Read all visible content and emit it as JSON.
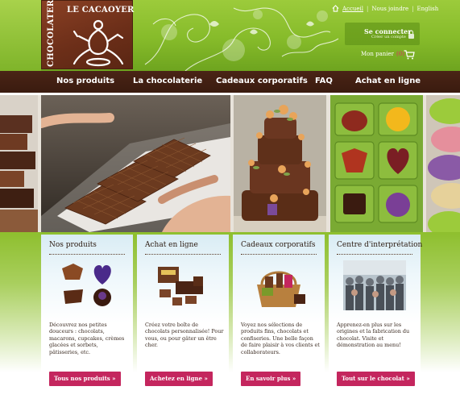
{
  "brand": {
    "name_vertical": "CHOCOLATERIE",
    "name_top": "LE CACAOYER"
  },
  "top_links": {
    "home": "Accueil",
    "join": "Nous joindre",
    "lang": "English"
  },
  "login": {
    "title": "Se connecter",
    "subtitle": "Créer un compte"
  },
  "cart": {
    "label": "Mon panier",
    "count": "(0)"
  },
  "nav": {
    "items": [
      "Nos produits",
      "La chocolaterie",
      "Cadeaux corporatifs",
      "FAQ",
      "Achat en ligne"
    ]
  },
  "columns": [
    {
      "title": "Nos produits",
      "text": "Découvrez nos petites douceurs : chocolats, macarons, cupcakes, crèmes glacées et sorbets, pâtisseries, etc.",
      "button": "Tous nos produits »"
    },
    {
      "title": "Achat en ligne",
      "text": "Créez votre boîte de chocolats personnalisée! Pour vous, ou pour gâter un être cher.",
      "button": "Achetez en ligne »"
    },
    {
      "title": "Cadeaux corporatifs",
      "text": "Voyez nos sélections de produits fins, chocolats et confiseries. Une belle façon de faire plaisir à vos clients et collaborateurs.",
      "button": "En savoir plus »"
    },
    {
      "title": "Centre d'interprétation",
      "text": "Apprenez-en plus sur les origines et la fabrication du chocolat. Visite et démonstration au menu!",
      "button": "Tout sur le chocolat »"
    }
  ],
  "colors": {
    "green": "#86bb2a",
    "brown": "#3a1b0f",
    "pink": "#c4265e"
  }
}
